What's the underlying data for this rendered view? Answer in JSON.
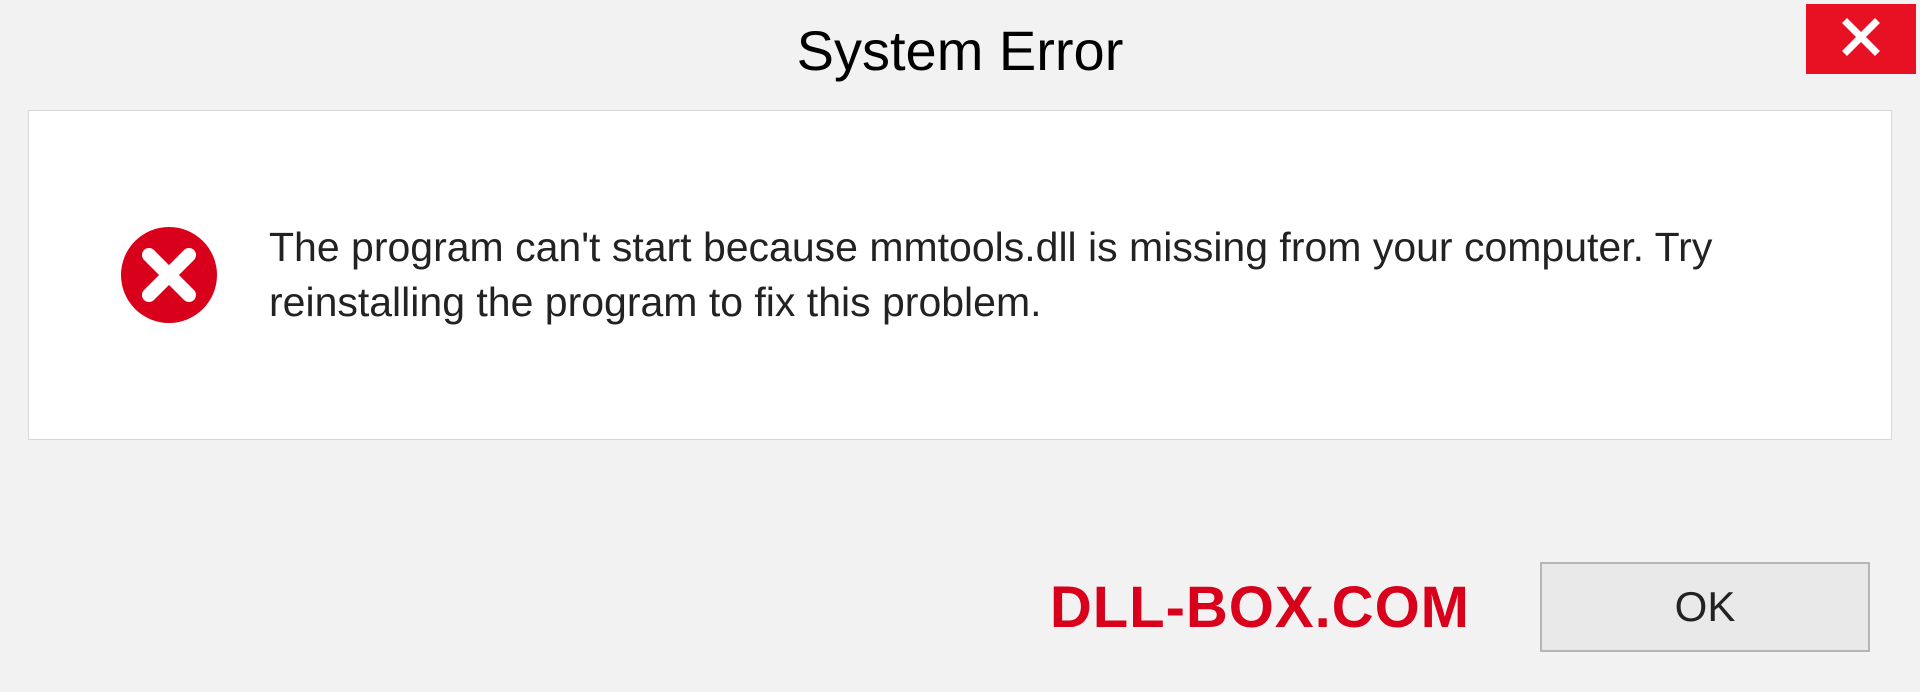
{
  "titlebar": {
    "title": "System Error"
  },
  "content": {
    "message": "The program can't start because mmtools.dll is missing from your computer. Try reinstalling the program to fix this problem."
  },
  "footer": {
    "watermark": "DLL-BOX.COM",
    "ok_label": "OK"
  },
  "colors": {
    "close_bg": "#e81123",
    "error_icon": "#d9001b",
    "watermark": "#d9001b"
  }
}
